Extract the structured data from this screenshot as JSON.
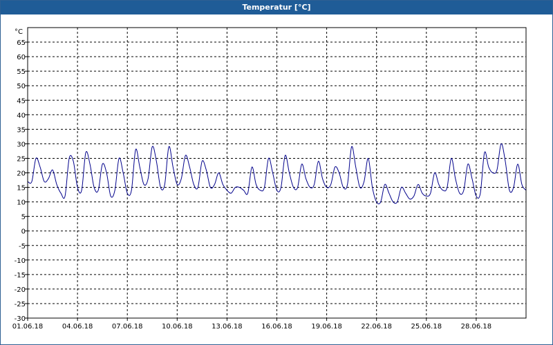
{
  "window": {
    "title": "Temperatur [°C]"
  },
  "colors": {
    "title_bar": "#1f5c97",
    "series_line": "#00008b",
    "grid": "#000000",
    "axis": "#000000"
  },
  "chart_data": {
    "type": "line",
    "title": "Temperatur [°C]",
    "ylabel": "°C",
    "ylim": [
      -30,
      70
    ],
    "yticks": [
      65,
      60,
      55,
      50,
      45,
      40,
      35,
      30,
      25,
      20,
      15,
      10,
      5,
      0,
      -5,
      -10,
      -15,
      -20,
      -25,
      -30
    ],
    "xlim": [
      "2018-06-01",
      "2018-07-01"
    ],
    "xticks": [
      {
        "date": "2018-06-01",
        "label": "01.06.18"
      },
      {
        "date": "2018-06-04",
        "label": "04.06.18"
      },
      {
        "date": "2018-06-07",
        "label": "07.06.18"
      },
      {
        "date": "2018-06-10",
        "label": "10.06.18"
      },
      {
        "date": "2018-06-13",
        "label": "13.06.18"
      },
      {
        "date": "2018-06-16",
        "label": "16.06.18"
      },
      {
        "date": "2018-06-19",
        "label": "19.06.18"
      },
      {
        "date": "2018-06-22",
        "label": "22.06.18"
      },
      {
        "date": "2018-06-25",
        "label": "25.06.18"
      },
      {
        "date": "2018-06-28",
        "label": "28.06.18"
      }
    ],
    "grid": true,
    "series": [
      {
        "x": [
          "2018-06-01T00:00",
          "2018-06-01T06:00",
          "2018-06-01T12:00",
          "2018-06-01T18:00",
          "2018-06-02T00:00",
          "2018-06-02T06:00",
          "2018-06-02T12:00",
          "2018-06-02T18:00",
          "2018-06-03T00:00",
          "2018-06-03T06:00",
          "2018-06-03T12:00",
          "2018-06-03T18:00",
          "2018-06-04T00:00",
          "2018-06-04T06:00",
          "2018-06-04T12:00",
          "2018-06-04T18:00",
          "2018-06-05T00:00",
          "2018-06-05T06:00",
          "2018-06-05T12:00",
          "2018-06-05T18:00",
          "2018-06-06T00:00",
          "2018-06-06T06:00",
          "2018-06-06T12:00",
          "2018-06-06T18:00",
          "2018-06-07T00:00",
          "2018-06-07T06:00",
          "2018-06-07T12:00",
          "2018-06-07T18:00",
          "2018-06-08T00:00",
          "2018-06-08T06:00",
          "2018-06-08T12:00",
          "2018-06-08T18:00",
          "2018-06-09T00:00",
          "2018-06-09T06:00",
          "2018-06-09T12:00",
          "2018-06-09T18:00",
          "2018-06-10T00:00",
          "2018-06-10T06:00",
          "2018-06-10T12:00",
          "2018-06-10T18:00",
          "2018-06-11T00:00",
          "2018-06-11T06:00",
          "2018-06-11T12:00",
          "2018-06-11T18:00",
          "2018-06-12T00:00",
          "2018-06-12T06:00",
          "2018-06-12T12:00",
          "2018-06-12T18:00",
          "2018-06-13T00:00",
          "2018-06-13T06:00",
          "2018-06-13T12:00",
          "2018-06-13T18:00",
          "2018-06-14T00:00",
          "2018-06-14T06:00",
          "2018-06-14T12:00",
          "2018-06-14T18:00",
          "2018-06-15T00:00",
          "2018-06-15T06:00",
          "2018-06-15T12:00",
          "2018-06-15T18:00",
          "2018-06-16T00:00",
          "2018-06-16T06:00",
          "2018-06-16T12:00",
          "2018-06-16T18:00",
          "2018-06-17T00:00",
          "2018-06-17T06:00",
          "2018-06-17T12:00",
          "2018-06-17T18:00",
          "2018-06-18T00:00",
          "2018-06-18T06:00",
          "2018-06-18T12:00",
          "2018-06-18T18:00",
          "2018-06-19T00:00",
          "2018-06-19T06:00",
          "2018-06-19T12:00",
          "2018-06-19T18:00",
          "2018-06-20T00:00",
          "2018-06-20T06:00",
          "2018-06-20T12:00",
          "2018-06-20T18:00",
          "2018-06-21T00:00",
          "2018-06-21T06:00",
          "2018-06-21T12:00",
          "2018-06-21T18:00",
          "2018-06-22T00:00",
          "2018-06-22T06:00",
          "2018-06-22T12:00",
          "2018-06-22T18:00",
          "2018-06-23T00:00",
          "2018-06-23T06:00",
          "2018-06-23T12:00",
          "2018-06-23T18:00",
          "2018-06-24T00:00",
          "2018-06-24T06:00",
          "2018-06-24T12:00",
          "2018-06-24T18:00",
          "2018-06-25T00:00",
          "2018-06-25T06:00",
          "2018-06-25T12:00",
          "2018-06-25T18:00",
          "2018-06-26T00:00",
          "2018-06-26T06:00",
          "2018-06-26T12:00",
          "2018-06-26T18:00",
          "2018-06-27T00:00",
          "2018-06-27T06:00",
          "2018-06-27T12:00",
          "2018-06-27T18:00",
          "2018-06-28T00:00",
          "2018-06-28T06:00",
          "2018-06-28T12:00",
          "2018-06-28T18:00",
          "2018-06-29T00:00",
          "2018-06-29T06:00",
          "2018-06-29T12:00",
          "2018-06-29T18:00",
          "2018-06-30T00:00",
          "2018-06-30T06:00",
          "2018-06-30T12:00",
          "2018-06-30T18:00",
          "2018-07-01T00:00"
        ],
        "values": [
          17,
          17,
          25,
          22,
          17,
          18,
          21,
          16,
          13,
          12,
          25,
          24,
          15,
          14,
          27,
          23,
          15,
          14,
          23,
          20,
          12,
          14,
          25,
          20,
          13,
          14,
          28,
          22,
          16,
          18,
          29,
          24,
          15,
          16,
          29,
          22,
          16,
          18,
          26,
          22,
          16,
          15,
          24,
          21,
          15,
          16,
          20,
          16,
          14,
          13,
          15,
          15,
          14,
          13,
          22,
          16,
          14,
          15,
          25,
          20,
          14,
          15,
          26,
          20,
          15,
          15,
          23,
          18,
          15,
          16,
          24,
          18,
          15,
          16,
          22,
          20,
          15,
          16,
          29,
          22,
          15,
          17,
          25,
          15,
          10,
          10,
          16,
          13,
          10,
          10,
          15,
          13,
          11,
          12,
          16,
          13,
          12,
          13,
          20,
          16,
          14,
          15,
          25,
          18,
          13,
          14,
          23,
          18,
          12,
          13,
          27,
          22,
          20,
          21,
          30,
          24,
          14,
          15,
          23,
          16,
          14
        ]
      }
    ]
  }
}
